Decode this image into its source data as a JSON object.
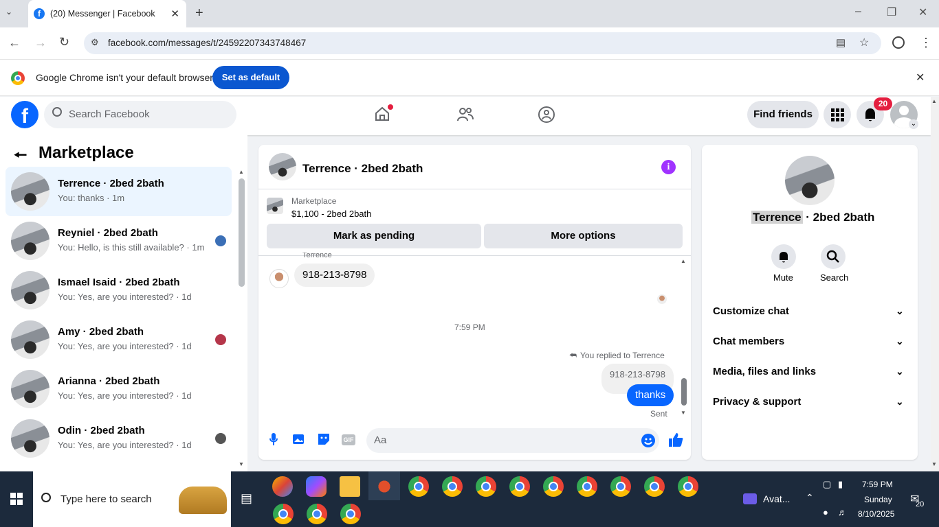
{
  "browser": {
    "tab_title": "(20) Messenger | Facebook",
    "tab_favicon": "f",
    "new_tab": "+",
    "url": "facebook.com/messages/t/24592207343748467",
    "infobar_text": "Google Chrome isn't your default browser",
    "set_default_label": "Set as default"
  },
  "facebook": {
    "logo": "f",
    "search_placeholder": "Search Facebook",
    "find_friends_label": "Find friends",
    "notification_count": "20",
    "brand_color": "#0866ff"
  },
  "sidebar": {
    "title": "Marketplace",
    "conversations": [
      {
        "name": "Terrence · 2bed 2bath",
        "preview": "You: thanks · 1m",
        "selected": true
      },
      {
        "name": "Reyniel · 2bed 2bath",
        "preview": "You: Hello, is this still available? · 1m"
      },
      {
        "name": "Ismael Isaid · 2bed 2bath",
        "preview": "You: Yes, are you interested? · 1d"
      },
      {
        "name": "Amy · 2bed 2bath",
        "preview": "You: Yes, are you interested? · 1d"
      },
      {
        "name": "Arianna · 2bed 2bath",
        "preview": "You: Yes, are you interested? · 1d"
      },
      {
        "name": "Odin · 2bed 2bath",
        "preview": "You: Yes, are you interested? · 1d"
      }
    ]
  },
  "chat": {
    "title": "Terrence · 2bed 2bath",
    "listing_category": "Marketplace",
    "listing_title": "$1,100 - 2bed 2bath",
    "mark_pending_label": "Mark as pending",
    "more_options_label": "More options",
    "sender_label": "Terrence",
    "received_message": "918-213-8798",
    "timestamp": "7:59 PM",
    "replied_label": "You replied to Terrence",
    "quoted_message": "918-213-8798",
    "sent_message": "thanks",
    "sent_status": "Sent",
    "composer_placeholder": "Aa",
    "gif_label": "GIF"
  },
  "profile": {
    "first_name": "Terrence",
    "name_rest": " · 2bed 2bath",
    "mute_label": "Mute",
    "search_label": "Search",
    "options": [
      "Customize chat",
      "Chat members",
      "Media, files and links",
      "Privacy & support"
    ]
  },
  "taskbar": {
    "search_placeholder": "Type here to search",
    "avatar_app_label": "Avat...",
    "time": "7:59 PM",
    "day": "Sunday",
    "date": "8/10/2025",
    "notification_count": "20"
  }
}
